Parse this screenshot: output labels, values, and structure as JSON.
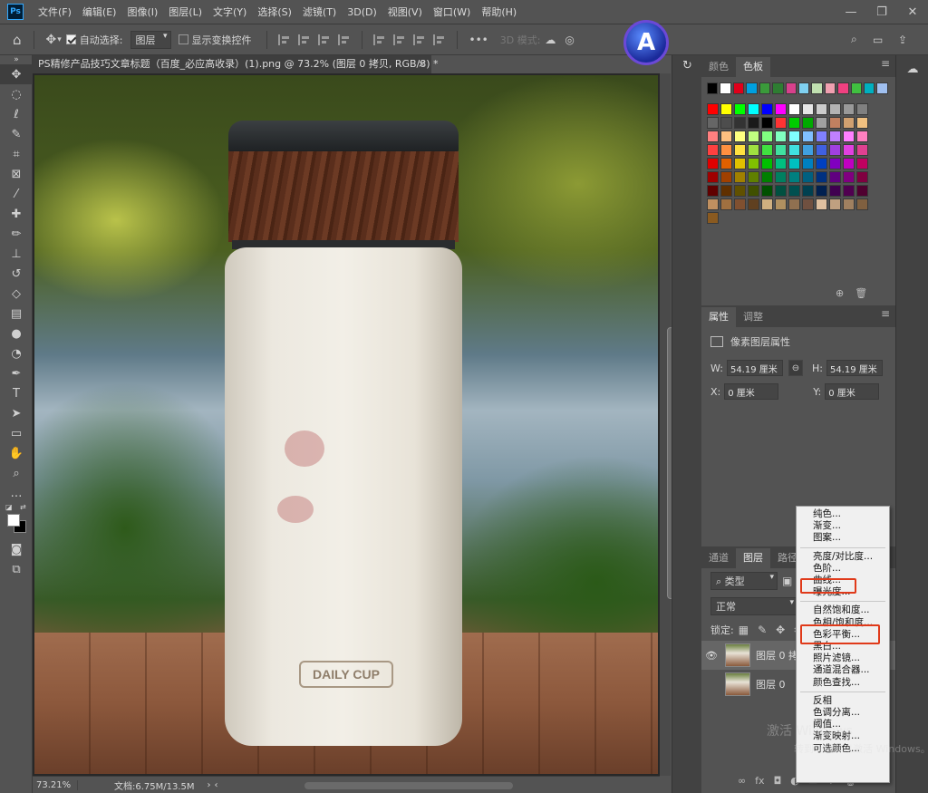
{
  "app": {
    "logo": "Ps"
  },
  "menu": [
    "文件(F)",
    "编辑(E)",
    "图像(I)",
    "图层(L)",
    "文字(Y)",
    "选择(S)",
    "滤镜(T)",
    "3D(D)",
    "视图(V)",
    "窗口(W)",
    "帮助(H)"
  ],
  "options": {
    "auto_select_label": "自动选择:",
    "auto_select_value": "图层",
    "show_transform_label": "显示变换控件",
    "more": "•••",
    "mode_3d": "3D 模式:"
  },
  "profile": {
    "letter": "A"
  },
  "document": {
    "tab_title": "PS精修产品技巧文章标题（百度_必应高收录）(1).png @ 73.2% (图层 0 拷贝, RGB/8) *",
    "close": "×"
  },
  "product": {
    "logo_text": "DAILY CUP"
  },
  "status": {
    "zoom": "73.21%",
    "doc_info": "文档:6.75M/13.5M"
  },
  "swatch_panel": {
    "tabs": [
      "颜色",
      "色板"
    ],
    "active": "色板",
    "recent": [
      "#000000",
      "#ffffff",
      "#e0001a",
      "#00a0e0",
      "#3a9a3a",
      "#2e7d32",
      "#d8408c",
      "#7fd0f0",
      "#c0e0b0",
      "#f0a0b0",
      "#f04080",
      "#40c040",
      "#00b0c0",
      "#a0c0f0"
    ],
    "grid": [
      [
        "#ff0000",
        "#ffff00",
        "#00ff00",
        "#00ffff",
        "#0000ff",
        "#ff00ff",
        "#ffffff",
        "#e6e6e6",
        "#cccccc",
        "#b3b3b3",
        "#999999",
        "#808080"
      ],
      [
        "#666666",
        "#4d4d4d",
        "#333333",
        "#1a1a1a",
        "#000000",
        "#ff3333",
        "#00cc00",
        "#00aa00",
        "#a0a0a0",
        "#c08060",
        "#d0a070",
        "#f0c080"
      ],
      [
        "#ff8080",
        "#ffc080",
        "#ffff80",
        "#c0ff80",
        "#80ff80",
        "#80ffc0",
        "#80ffff",
        "#80c0ff",
        "#8080ff",
        "#c080ff",
        "#ff80ff",
        "#ff80c0"
      ],
      [
        "#ff4040",
        "#ff9040",
        "#ffe040",
        "#a0e040",
        "#40e040",
        "#40e0a0",
        "#40e0e0",
        "#40a0e0",
        "#4060e0",
        "#a040e0",
        "#e040e0",
        "#e04090"
      ],
      [
        "#e00000",
        "#e06000",
        "#e0c000",
        "#80c000",
        "#00c000",
        "#00c080",
        "#00c0c0",
        "#0080c0",
        "#0040c0",
        "#8000c0",
        "#c000c0",
        "#c00060"
      ],
      [
        "#a00000",
        "#a04000",
        "#a08000",
        "#608000",
        "#008000",
        "#008060",
        "#008080",
        "#006080",
        "#003080",
        "#600080",
        "#800080",
        "#800040"
      ],
      [
        "#600000",
        "#603000",
        "#605000",
        "#405000",
        "#005000",
        "#005040",
        "#005050",
        "#004050",
        "#002050",
        "#400050",
        "#500050",
        "#500030"
      ],
      [
        "#c09060",
        "#a07040",
        "#805030",
        "#604020",
        "#d0b080",
        "#b09060",
        "#907050",
        "#705040",
        "#e0c0a0",
        "#c0a080",
        "#a08060",
        "#806040"
      ],
      [
        "#8a5a20"
      ]
    ]
  },
  "properties_panel": {
    "tabs": [
      "属性",
      "调整"
    ],
    "active": "属性",
    "title": "像素图层属性",
    "w_label": "W:",
    "w_value": "54.19 厘米",
    "h_label": "H:",
    "h_value": "54.19 厘米",
    "x_label": "X:",
    "x_value": "0 厘米",
    "y_label": "Y:",
    "y_value": "0 厘米",
    "link": "⊖"
  },
  "layers_panel": {
    "tabs": [
      "通道",
      "图层",
      "路径"
    ],
    "active": "图层",
    "filter_kind": "类型",
    "blend_mode": "正常",
    "lock_label": "锁定:",
    "layers": [
      {
        "name": "图层 0 拷贝",
        "visible": true,
        "selected": true
      },
      {
        "name": "图层 0",
        "visible": false,
        "selected": false
      }
    ],
    "footer": [
      "∞",
      "fx",
      "◘",
      "◐",
      "▭",
      "+",
      "🗑"
    ]
  },
  "context_menu": {
    "items": [
      [
        "纯色...",
        "渐变...",
        "图案..."
      ],
      [
        "亮度/对比度...",
        "色阶...",
        "曲线...",
        "曝光度..."
      ],
      [
        "自然饱和度...",
        "色相/饱和度...",
        "色彩平衡...",
        "黑白...",
        "照片滤镜...",
        "通道混合器...",
        "颜色查找..."
      ],
      [
        "反相",
        "色调分离...",
        "阈值...",
        "渐变映射...",
        "可选颜色..."
      ]
    ],
    "highlighted": [
      "曲线...",
      "色相/饱和度..."
    ]
  },
  "watermark": {
    "line1": "激活 Windows",
    "line2": "转到\"设置\"以激活 Windows。"
  }
}
